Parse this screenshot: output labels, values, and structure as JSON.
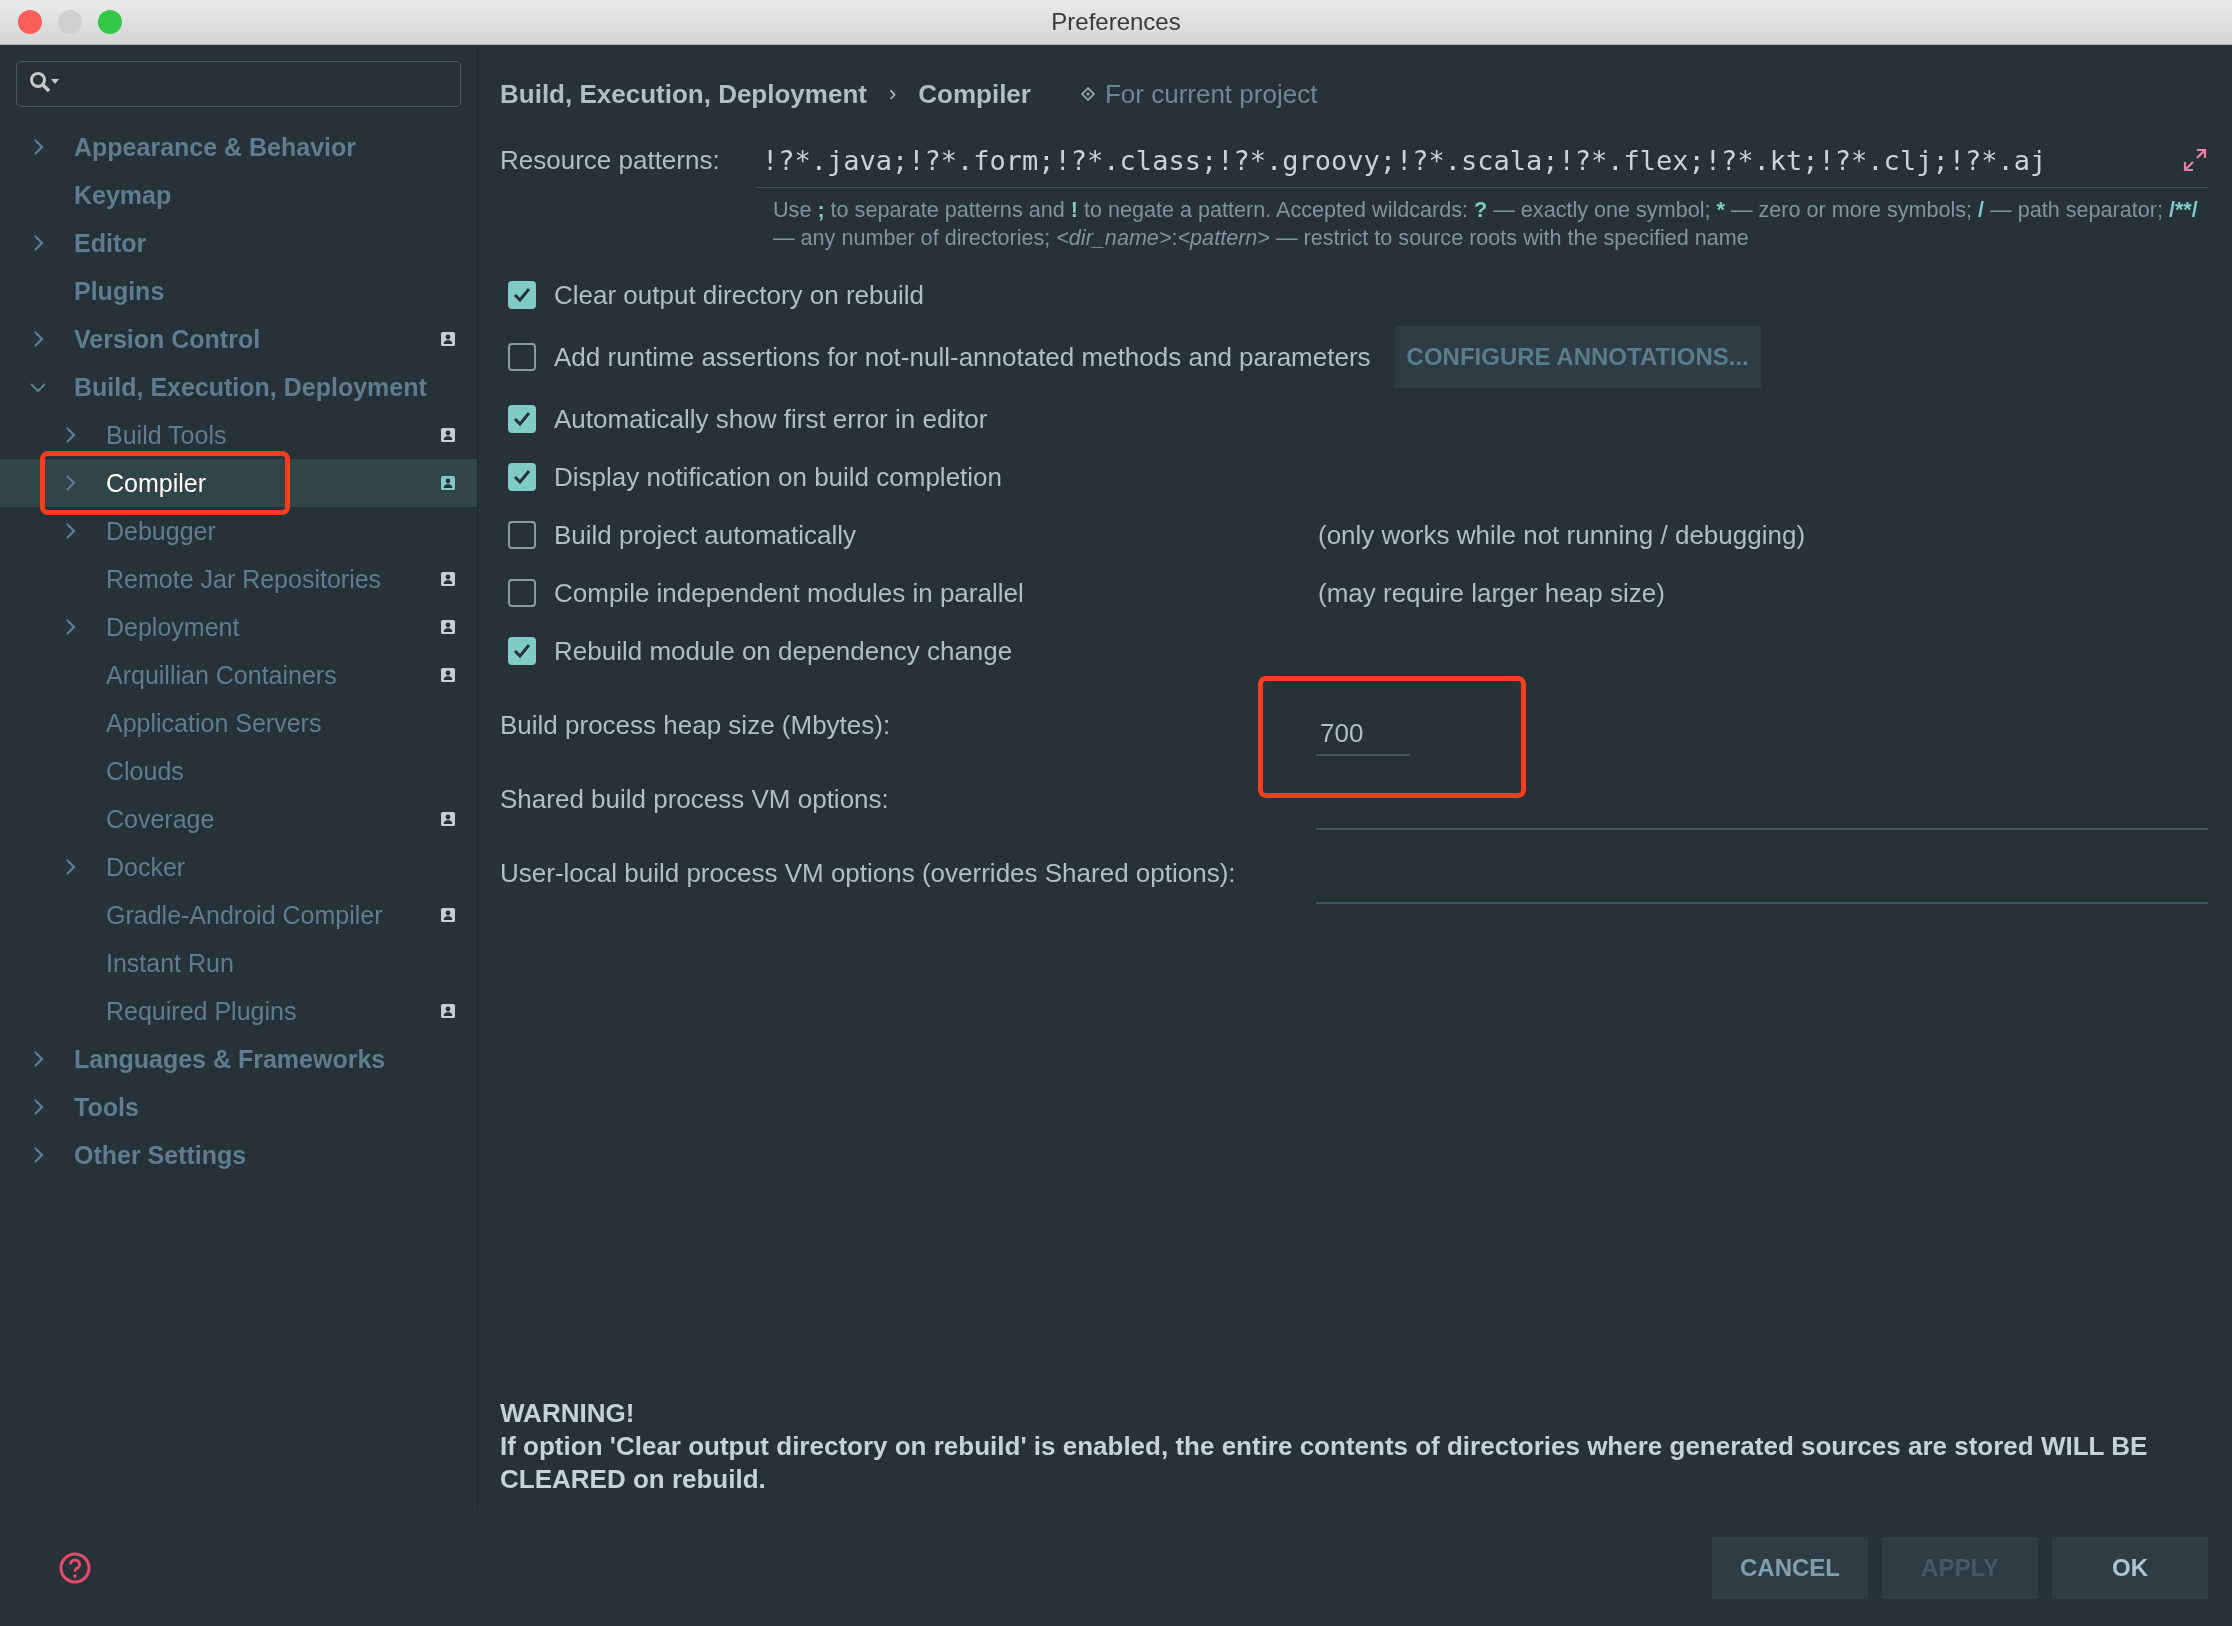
{
  "window": {
    "title": "Preferences"
  },
  "sidebar": {
    "items": [
      {
        "label": "Appearance & Behavior",
        "expandable": true,
        "expanded": false,
        "selected": false,
        "project_scope": false,
        "highlighted": false
      },
      {
        "label": "Keymap",
        "expandable": false,
        "expanded": false,
        "selected": false,
        "project_scope": false,
        "highlighted": false
      },
      {
        "label": "Editor",
        "expandable": true,
        "expanded": false,
        "selected": false,
        "project_scope": false,
        "highlighted": false
      },
      {
        "label": "Plugins",
        "expandable": false,
        "expanded": false,
        "selected": false,
        "project_scope": false,
        "highlighted": false
      },
      {
        "label": "Version Control",
        "expandable": true,
        "expanded": false,
        "selected": false,
        "project_scope": true,
        "highlighted": false
      },
      {
        "label": "Build, Execution, Deployment",
        "expandable": true,
        "expanded": true,
        "selected": false,
        "project_scope": false,
        "highlighted": false,
        "children": [
          {
            "label": "Build Tools",
            "expandable": true,
            "expanded": false,
            "selected": false,
            "project_scope": true,
            "highlighted": false
          },
          {
            "label": "Compiler",
            "expandable": true,
            "expanded": false,
            "selected": true,
            "project_scope": true,
            "highlighted": true
          },
          {
            "label": "Debugger",
            "expandable": true,
            "expanded": false,
            "selected": false,
            "project_scope": false,
            "highlighted": false
          },
          {
            "label": "Remote Jar Repositories",
            "expandable": false,
            "expanded": false,
            "selected": false,
            "project_scope": true,
            "highlighted": false
          },
          {
            "label": "Deployment",
            "expandable": true,
            "expanded": false,
            "selected": false,
            "project_scope": true,
            "highlighted": false
          },
          {
            "label": "Arquillian Containers",
            "expandable": false,
            "expanded": false,
            "selected": false,
            "project_scope": true,
            "highlighted": false
          },
          {
            "label": "Application Servers",
            "expandable": false,
            "expanded": false,
            "selected": false,
            "project_scope": false,
            "highlighted": false
          },
          {
            "label": "Clouds",
            "expandable": false,
            "expanded": false,
            "selected": false,
            "project_scope": false,
            "highlighted": false
          },
          {
            "label": "Coverage",
            "expandable": false,
            "expanded": false,
            "selected": false,
            "project_scope": true,
            "highlighted": false
          },
          {
            "label": "Docker",
            "expandable": true,
            "expanded": false,
            "selected": false,
            "project_scope": false,
            "highlighted": false
          },
          {
            "label": "Gradle-Android Compiler",
            "expandable": false,
            "expanded": false,
            "selected": false,
            "project_scope": true,
            "highlighted": false
          },
          {
            "label": "Instant Run",
            "expandable": false,
            "expanded": false,
            "selected": false,
            "project_scope": false,
            "highlighted": false
          },
          {
            "label": "Required Plugins",
            "expandable": false,
            "expanded": false,
            "selected": false,
            "project_scope": true,
            "highlighted": false
          }
        ]
      },
      {
        "label": "Languages & Frameworks",
        "expandable": true,
        "expanded": false,
        "selected": false,
        "project_scope": false,
        "highlighted": false
      },
      {
        "label": "Tools",
        "expandable": true,
        "expanded": false,
        "selected": false,
        "project_scope": false,
        "highlighted": false
      },
      {
        "label": "Other Settings",
        "expandable": true,
        "expanded": false,
        "selected": false,
        "project_scope": false,
        "highlighted": false
      }
    ]
  },
  "breadcrumb": {
    "parts": [
      "Build, Execution, Deployment",
      "Compiler"
    ],
    "separator": "›",
    "scope": "For current project"
  },
  "resource_patterns": {
    "label": "Resource patterns:",
    "value": "!?*.java;!?*.form;!?*.class;!?*.groovy;!?*.scala;!?*.flex;!?*.kt;!?*.clj;!?*.aj",
    "hint": [
      {
        "kind": "plain",
        "text": "Use "
      },
      {
        "kind": "code",
        "text": ";"
      },
      {
        "kind": "plain",
        "text": " to separate patterns and "
      },
      {
        "kind": "code",
        "text": "!"
      },
      {
        "kind": "plain",
        "text": " to negate a pattern. Accepted wildcards: "
      },
      {
        "kind": "code",
        "text": "?"
      },
      {
        "kind": "plain",
        "text": " — exactly one symbol; "
      },
      {
        "kind": "code",
        "text": "*"
      },
      {
        "kind": "plain",
        "text": " — zero or more symbols; "
      },
      {
        "kind": "code",
        "text": "/"
      },
      {
        "kind": "plain",
        "text": " — path separator; "
      },
      {
        "kind": "code",
        "text": "/**/"
      },
      {
        "kind": "plain",
        "text": " — any number of directories; "
      },
      {
        "kind": "italic",
        "text": "<dir_name>"
      },
      {
        "kind": "plain",
        "text": ":"
      },
      {
        "kind": "italic",
        "text": "<pattern>"
      },
      {
        "kind": "plain",
        "text": " — restrict to source roots with the specified name"
      }
    ]
  },
  "options": [
    {
      "label": "Clear output directory on rebuild",
      "checked": true
    },
    {
      "label": "Add runtime assertions for not-null-annotated methods and parameters",
      "checked": false,
      "button": "CONFIGURE ANNOTATIONS..."
    },
    {
      "label": "Automatically show first error in editor",
      "checked": true
    },
    {
      "label": "Display notification on build completion",
      "checked": true
    },
    {
      "label": "Build project automatically",
      "checked": false,
      "note": "(only works while not running / debugging)"
    },
    {
      "label": "Compile independent modules in parallel",
      "checked": false,
      "note": "(may require larger heap size)"
    },
    {
      "label": "Rebuild module on dependency change",
      "checked": true
    }
  ],
  "fields": [
    {
      "kind": "short",
      "label": "Build process heap size (Mbytes):",
      "value": "700",
      "highlighted": true
    },
    {
      "kind": "wide",
      "label": "Shared build process VM options:",
      "highlighted": false
    },
    {
      "kind": "wide",
      "label": "User-local build process VM options (overrides Shared options):",
      "highlighted": false
    }
  ],
  "warning": {
    "title": "WARNING!",
    "text": "If option 'Clear output directory on rebuild' is enabled, the entire contents of directories where generated sources are stored WILL BE CLEARED on rebuild."
  },
  "buttons": [
    {
      "label": "CANCEL",
      "disabled": false,
      "default": false
    },
    {
      "label": "APPLY",
      "disabled": true,
      "default": false
    },
    {
      "label": "OK",
      "disabled": false,
      "default": true
    }
  ]
}
